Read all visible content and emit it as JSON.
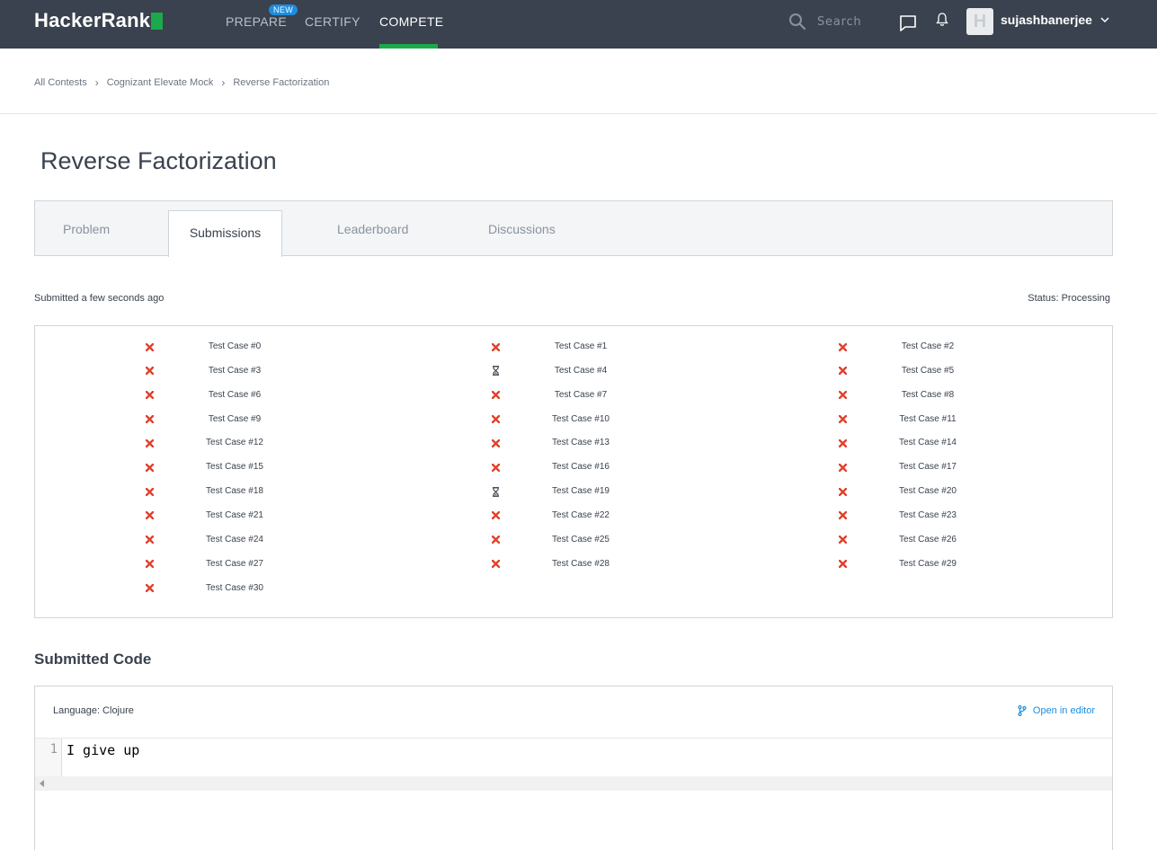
{
  "nav": {
    "logo_text": "HackerRank",
    "links": [
      "PREPARE",
      "CERTIFY",
      "COMPETE"
    ],
    "new_badge": "NEW",
    "search_placeholder": "Search",
    "username": "sujashbanerjee",
    "avatar_letter": "H",
    "accent_color": "#1ba94c",
    "bar_color": "#39424e"
  },
  "breadcrumb": [
    "All Contests",
    "Cognizant Elevate Mock",
    "Reverse Factorization"
  ],
  "page_title": "Reverse Factorization",
  "tabs": [
    "Problem",
    "Submissions",
    "Leaderboard",
    "Discussions"
  ],
  "active_tab": "Submissions",
  "submission": {
    "submitted_at": "Submitted a few seconds ago",
    "status": "Status: Processing"
  },
  "test_cases": [
    {
      "label": "Test Case #0",
      "state": "failed"
    },
    {
      "label": "Test Case #1",
      "state": "failed"
    },
    {
      "label": "Test Case #2",
      "state": "failed"
    },
    {
      "label": "Test Case #3",
      "state": "failed"
    },
    {
      "label": "Test Case #4",
      "state": "processing"
    },
    {
      "label": "Test Case #5",
      "state": "failed"
    },
    {
      "label": "Test Case #6",
      "state": "failed"
    },
    {
      "label": "Test Case #7",
      "state": "failed"
    },
    {
      "label": "Test Case #8",
      "state": "failed"
    },
    {
      "label": "Test Case #9",
      "state": "failed"
    },
    {
      "label": "Test Case #10",
      "state": "failed"
    },
    {
      "label": "Test Case #11",
      "state": "failed"
    },
    {
      "label": "Test Case #12",
      "state": "failed"
    },
    {
      "label": "Test Case #13",
      "state": "failed"
    },
    {
      "label": "Test Case #14",
      "state": "failed"
    },
    {
      "label": "Test Case #15",
      "state": "failed"
    },
    {
      "label": "Test Case #16",
      "state": "failed"
    },
    {
      "label": "Test Case #17",
      "state": "failed"
    },
    {
      "label": "Test Case #18",
      "state": "failed"
    },
    {
      "label": "Test Case #19",
      "state": "processing"
    },
    {
      "label": "Test Case #20",
      "state": "failed"
    },
    {
      "label": "Test Case #21",
      "state": "failed"
    },
    {
      "label": "Test Case #22",
      "state": "failed"
    },
    {
      "label": "Test Case #23",
      "state": "failed"
    },
    {
      "label": "Test Case #24",
      "state": "failed"
    },
    {
      "label": "Test Case #25",
      "state": "failed"
    },
    {
      "label": "Test Case #26",
      "state": "failed"
    },
    {
      "label": "Test Case #27",
      "state": "failed"
    },
    {
      "label": "Test Case #28",
      "state": "failed"
    },
    {
      "label": "Test Case #29",
      "state": "failed"
    },
    {
      "label": "Test Case #30",
      "state": "failed"
    }
  ],
  "state_colors": {
    "failed": "#e0412f",
    "processing": "#39424e"
  },
  "code": {
    "heading": "Submitted Code",
    "language": "Language: Clojure",
    "open_in_editor": "Open in editor",
    "line_number": "1",
    "line_text": "I give up"
  }
}
